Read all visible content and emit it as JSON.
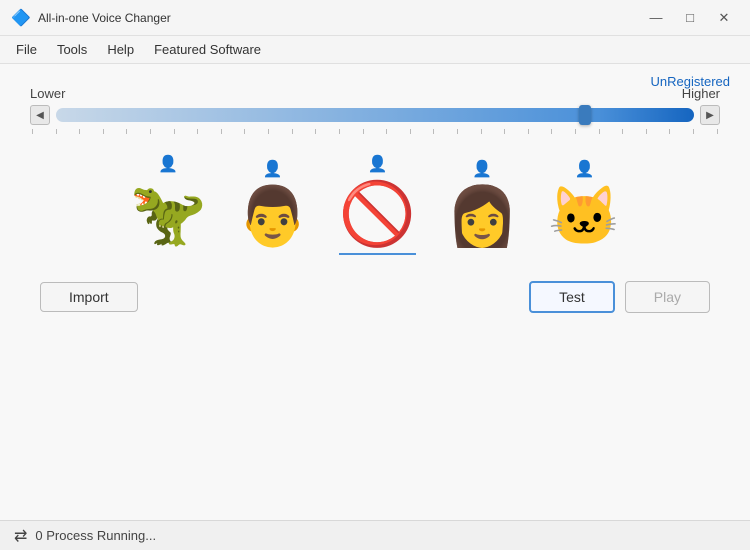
{
  "titleBar": {
    "icon": "🔷",
    "title": "All-in-one Voice Changer",
    "minimizeLabel": "—",
    "maximizeLabel": "□",
    "closeLabel": "✕"
  },
  "menuBar": {
    "items": [
      {
        "id": "file",
        "label": "File"
      },
      {
        "id": "tools",
        "label": "Tools"
      },
      {
        "id": "help",
        "label": "Help"
      },
      {
        "id": "featured-software",
        "label": "Featured Software"
      }
    ]
  },
  "mainArea": {
    "unregistered": "UnRegistered",
    "slider": {
      "lowerLabel": "Lower",
      "higherLabel": "Higher"
    },
    "characters": [
      {
        "id": "dragon",
        "emoji": "🦖",
        "label": "Dragon",
        "selected": false
      },
      {
        "id": "man",
        "emoji": "👨",
        "label": "Man",
        "selected": false
      },
      {
        "id": "none",
        "emoji": "🚫",
        "label": "None",
        "selected": true
      },
      {
        "id": "woman",
        "emoji": "👩",
        "label": "Woman",
        "selected": false
      },
      {
        "id": "cat",
        "emoji": "🐱",
        "label": "Cat",
        "selected": false
      }
    ],
    "buttons": {
      "import": "Import",
      "test": "Test",
      "play": "Play"
    }
  },
  "statusBar": {
    "icon": "⇄",
    "text": "0 Process Running..."
  }
}
